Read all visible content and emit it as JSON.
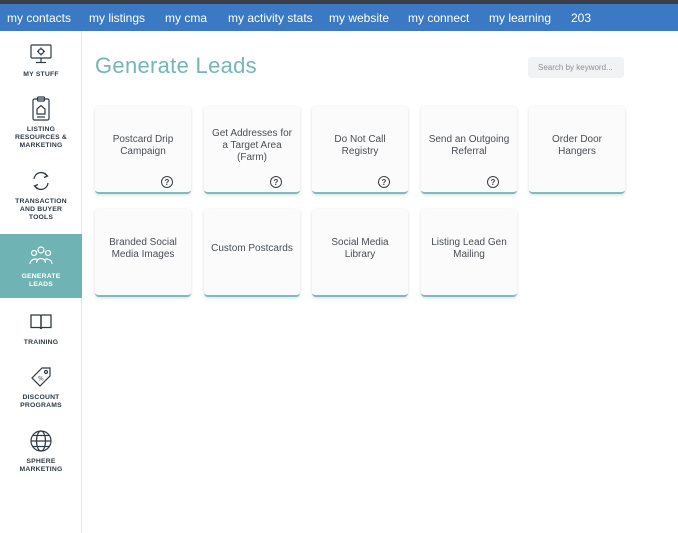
{
  "topnav": {
    "items": [
      {
        "label": "my contacts"
      },
      {
        "label": "my listings"
      },
      {
        "label": "my cma"
      },
      {
        "label": "my activity stats"
      },
      {
        "label": "my website"
      },
      {
        "label": "my connect"
      },
      {
        "label": "my learning"
      },
      {
        "label": "203"
      }
    ]
  },
  "sidebar": {
    "items": [
      {
        "label": "MY STUFF",
        "icon": "monitor-icon"
      },
      {
        "label": "LISTING RESOURCES & MARKETING",
        "icon": "clipboard-icon"
      },
      {
        "label": "TRANSACTION AND BUYER TOOLS",
        "icon": "exchange-icon"
      },
      {
        "label": "GENERATE LEADS",
        "icon": "people-icon",
        "active": true
      },
      {
        "label": "TRAINING",
        "icon": "book-icon"
      },
      {
        "label": "DISCOUNT PROGRAMS",
        "icon": "tag-icon"
      },
      {
        "label": "SPHERE MARKETING",
        "icon": "globe-icon"
      }
    ]
  },
  "main": {
    "title": "Generate Leads",
    "search_placeholder": "Search by keyword...",
    "cards": [
      {
        "label": "Postcard Drip Campaign",
        "help": true
      },
      {
        "label": "Get Addresses for a Target Area (Farm)",
        "help": true
      },
      {
        "label": "Do Not Call Registry",
        "help": true
      },
      {
        "label": "Send an Outgoing Referral",
        "help": true
      },
      {
        "label": "Order Door Hangers",
        "help": false
      },
      {
        "label": "Branded Social Media Images",
        "help": false
      },
      {
        "label": "Custom Postcards",
        "help": false
      },
      {
        "label": "Social Media Library",
        "help": false
      },
      {
        "label": "Listing Lead Gen Mailing",
        "help": false
      }
    ],
    "help_glyph": "?"
  },
  "colors": {
    "nav_bg": "#3b79c4",
    "accent_teal": "#6fb3b5",
    "title_teal": "#74b7b9"
  }
}
